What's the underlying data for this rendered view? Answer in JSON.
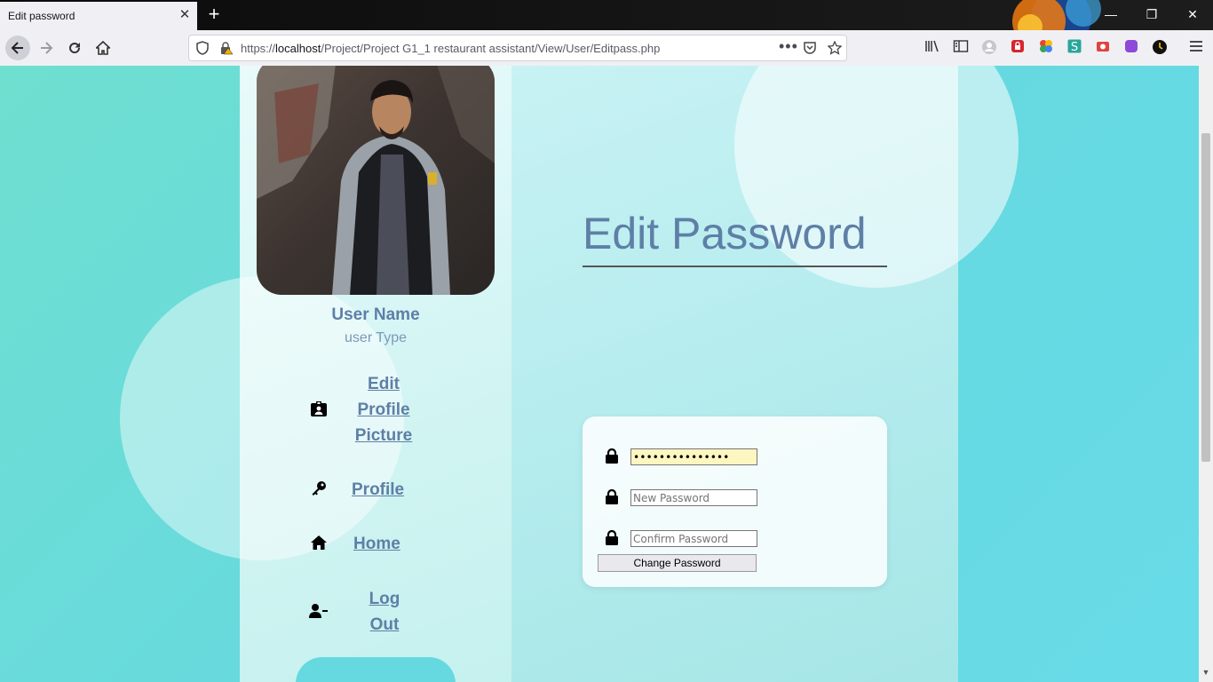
{
  "browser": {
    "tab_title": "Edit password",
    "tab_close": "✕",
    "new_tab": "+",
    "url_prefix": "https://",
    "url_host": "localhost",
    "url_path": "/Project/Project G1_1 restaurant assistant/View/User/Editpass.php",
    "window_minimize": "—",
    "window_restore": "❐",
    "window_close": "✕"
  },
  "profile": {
    "name": "User Name",
    "type": "user Type"
  },
  "nav": {
    "edit_picture": [
      "Edit",
      "Profile",
      "Picture"
    ],
    "profile": "Profile",
    "home": "Home",
    "logout": [
      "Log",
      "Out"
    ]
  },
  "main": {
    "title": "Edit Password"
  },
  "form": {
    "current_value": "•••••••••••••••",
    "new_placeholder": "New Password",
    "confirm_placeholder": "Confirm Password",
    "submit_label": "Change Password"
  },
  "colors": {
    "accent_text": "#5e7fa6",
    "page_bg": "#66d9e0",
    "autofill_bg": "#fdf6c0"
  }
}
